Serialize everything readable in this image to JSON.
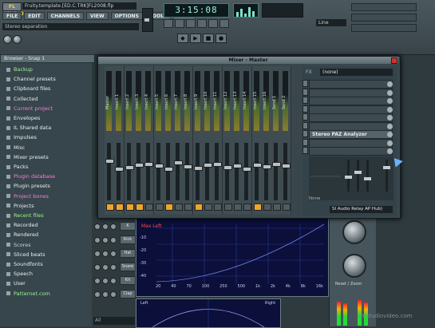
{
  "app": {
    "logo": "FL STUDIO",
    "project_title": "Fruity.template.[ED.C.TRK]FL2008.flp",
    "hint": "Stereo separation"
  },
  "menu": [
    "FILE",
    "EDIT",
    "CHANNELS",
    "VIEW",
    "OPTIONS",
    "TOOLS",
    "HELP"
  ],
  "transport": {
    "time": "3:15:08",
    "buttons": [
      "◆",
      "▶",
      "■",
      "●"
    ],
    "pattern": "Line"
  },
  "browser": {
    "title": "Browser - Snap 1",
    "items": [
      {
        "label": "Backup",
        "style": "gr"
      },
      {
        "label": "Channel presets",
        "style": "normal"
      },
      {
        "label": "Clipboard files",
        "style": "normal"
      },
      {
        "label": "Collected",
        "style": "normal"
      },
      {
        "label": "Current project",
        "style": "hl"
      },
      {
        "label": "Envelopes",
        "style": "normal"
      },
      {
        "label": "IL Shared data",
        "style": "normal"
      },
      {
        "label": "Impulses",
        "style": "normal"
      },
      {
        "label": "Misc",
        "style": "normal"
      },
      {
        "label": "Mixer presets",
        "style": "normal"
      },
      {
        "label": "Packs",
        "style": "normal"
      },
      {
        "label": "Plugin database",
        "style": "hl"
      },
      {
        "label": "Plugin presets",
        "style": "normal"
      },
      {
        "label": "Project bones",
        "style": "hl"
      },
      {
        "label": "Projects",
        "style": "normal"
      },
      {
        "label": "Recent files",
        "style": "gr"
      },
      {
        "label": "Recorded",
        "style": "normal"
      },
      {
        "label": "Rendered",
        "style": "normal"
      },
      {
        "label": "Scores",
        "style": "dim"
      },
      {
        "label": "Sliced beats",
        "style": "normal"
      },
      {
        "label": "Soundfonts",
        "style": "normal"
      },
      {
        "label": "Speech",
        "style": "normal"
      },
      {
        "label": "User",
        "style": "normal"
      },
      {
        "label": "Patternet.com",
        "style": "gr"
      }
    ],
    "filter": "All"
  },
  "channel_rack": {
    "buttons": [
      "K",
      "Kick",
      "Hat",
      "Snare",
      "Kit",
      "Clap"
    ]
  },
  "analyzer": {
    "label": "Max Left",
    "x_ticks": [
      "20",
      "40",
      "70",
      "100",
      "250",
      "500",
      "1k",
      "2k",
      "4k",
      "8k",
      "16k"
    ],
    "y_ticks": [
      "-10",
      "-20",
      "-30",
      "-40"
    ],
    "bottom_left": "Left",
    "bottom_right": "Right",
    "reset_label": "Reset / Zoom"
  },
  "mixer": {
    "title": "Mixer - Master",
    "strips": [
      {
        "name": "Master",
        "led": true
      },
      {
        "name": "Insert 1",
        "led": true
      },
      {
        "name": "Insert 2",
        "led": true
      },
      {
        "name": "Insert 3",
        "led": true
      },
      {
        "name": "Insert 4",
        "led": false
      },
      {
        "name": "Insert 5",
        "led": false
      },
      {
        "name": "Insert 6",
        "led": true
      },
      {
        "name": "Insert 7",
        "led": false
      },
      {
        "name": "Insert 8",
        "led": false
      },
      {
        "name": "Insert 9",
        "led": true
      },
      {
        "name": "Insert 10",
        "led": false
      },
      {
        "name": "Insert 11",
        "led": false
      },
      {
        "name": "Insert 12",
        "led": false
      },
      {
        "name": "Insert 13",
        "led": false
      },
      {
        "name": "Insert 14",
        "led": false
      },
      {
        "name": "Insert 15",
        "led": true
      },
      {
        "name": "Insert 16",
        "led": false
      },
      {
        "name": "Send 1",
        "led": false
      },
      {
        "name": "Send 2",
        "led": false
      }
    ],
    "fx": {
      "insert_label": "FX",
      "insert_name": "(none)",
      "slots": [
        "",
        "",
        "",
        "",
        "",
        "",
        "Stereo PAZ Analyzer",
        "",
        ""
      ],
      "selected_slot_index": 6,
      "none_label": "None",
      "route": "SI Audio Relay AP Hub)"
    }
  },
  "watermark": "ilmstudiovideo.com"
}
